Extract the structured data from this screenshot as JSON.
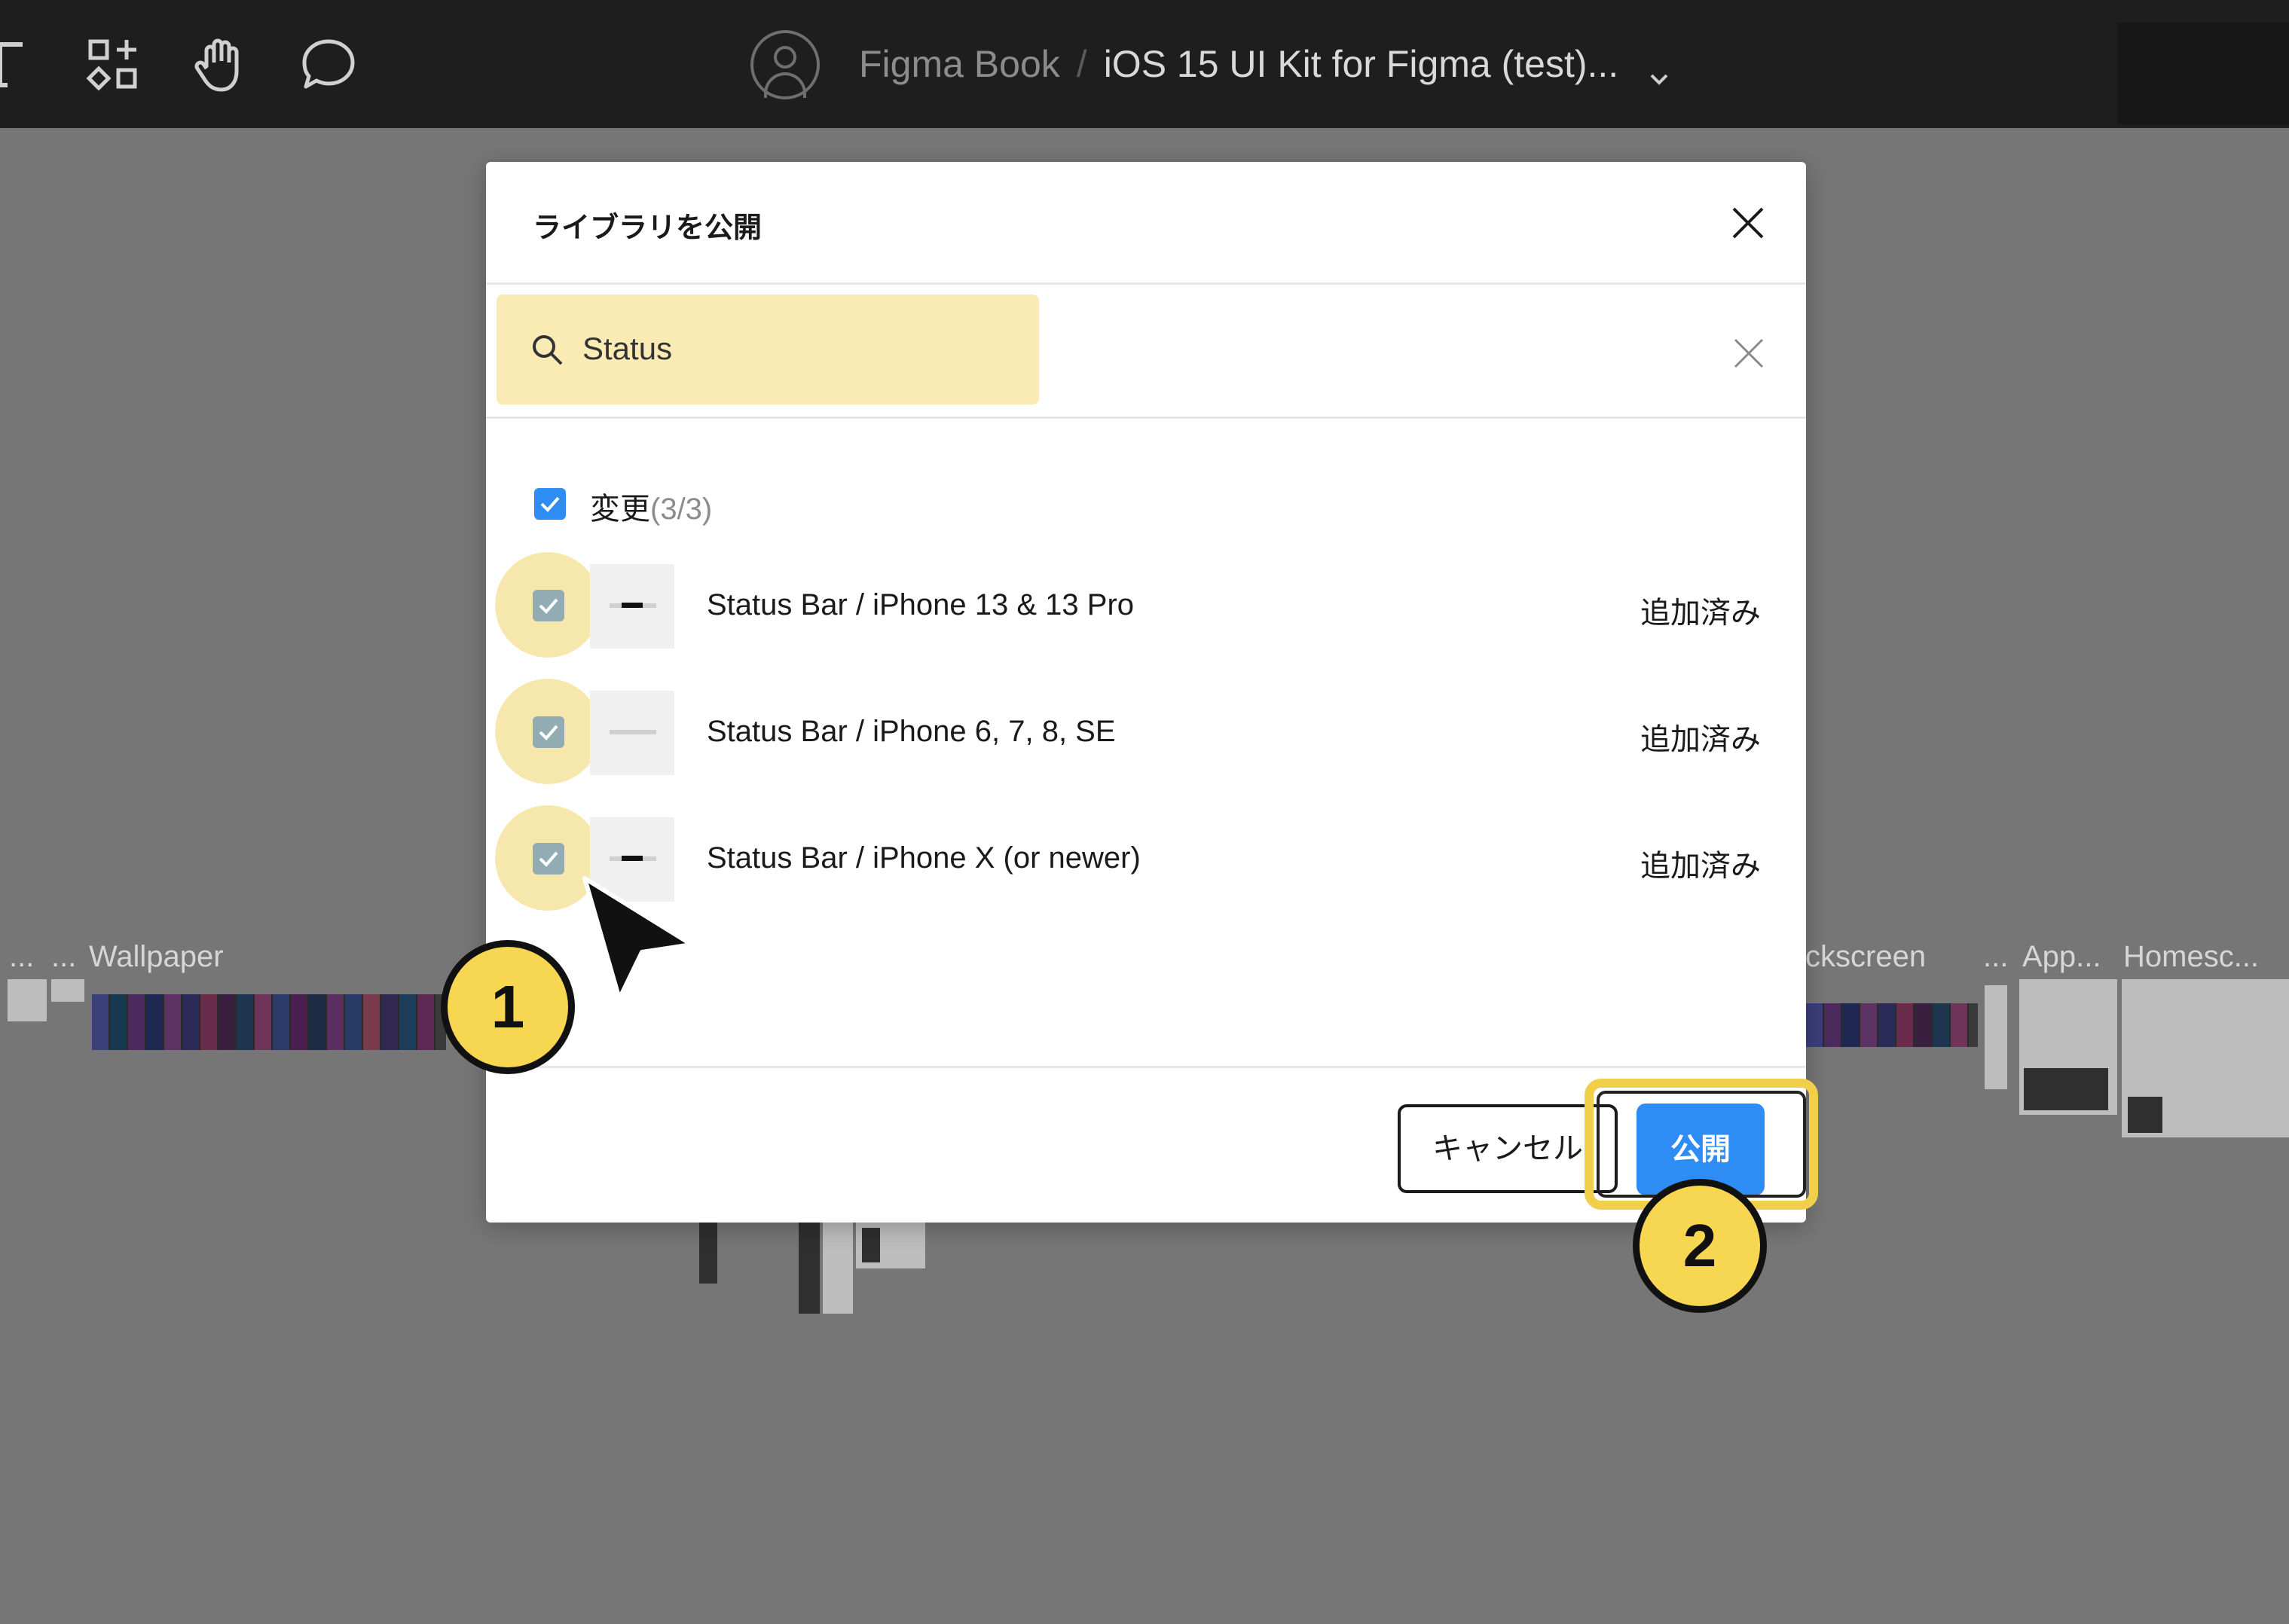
{
  "toolbar": {
    "tools": [
      "text-icon",
      "components-icon",
      "hand-icon",
      "comment-icon"
    ],
    "breadcrumb_team": "Figma Book",
    "breadcrumb_separator": "/",
    "breadcrumb_file": "iOS 15 UI Kit for Figma (test)...",
    "file_menu_icon": "chevron-down-icon"
  },
  "canvas": {
    "labels": {
      "dots_1": "...",
      "dots_2": "...",
      "wallpaper": "Wallpaper",
      "lockscreen": "ckscreen",
      "dots_3": "...",
      "app": "App...",
      "homescreen": "Homesc..."
    }
  },
  "dialog": {
    "title": "ライブラリを公開",
    "close_icon": "close-icon",
    "search": {
      "value": "Status",
      "placeholder": "",
      "icon": "search-icon",
      "clear_icon": "close-icon"
    },
    "changes": {
      "label": "変更",
      "count": "(3/3)",
      "checked": true
    },
    "items": [
      {
        "name": "Status Bar / iPhone 13 & 13 Pro",
        "status": "追加済み",
        "checked": true
      },
      {
        "name": "Status Bar / iPhone 6, 7, 8, SE",
        "status": "追加済み",
        "checked": true
      },
      {
        "name": "Status Bar / iPhone X (or newer)",
        "status": "追加済み",
        "checked": true
      }
    ],
    "cancel_label": "キャンセル",
    "publish_label": "公開"
  },
  "annotations": {
    "step_1": "1",
    "step_2": "2"
  },
  "colors": {
    "accent": "#2e8cf5",
    "highlight": "#f7d652",
    "search_bg": "#faeab4",
    "toolbar_bg": "#1e1e1e",
    "canvas_bg": "#767676"
  }
}
